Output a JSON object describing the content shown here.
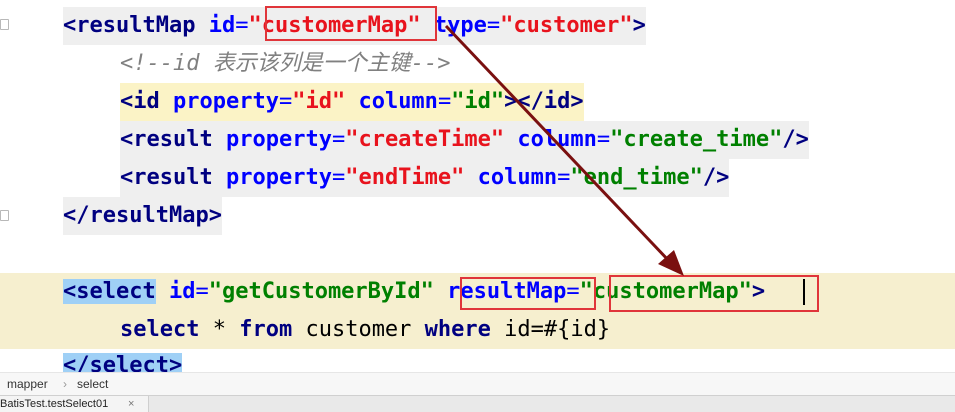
{
  "code": {
    "line1": {
      "open": "<",
      "tag": "resultMap",
      "sp1": " ",
      "attr1": "id",
      "eq1": "=",
      "val1": "\"customerMap\"",
      "sp2": " ",
      "attr2": "type",
      "eq2": "=",
      "val2": "\"customer\"",
      "close": ">"
    },
    "line2": {
      "comment": "<!--id 表示该列是一个主键-->"
    },
    "line3": {
      "open": "<",
      "tag": "id",
      "sp1": " ",
      "attr1": "property",
      "eq1": "=",
      "val1": "\"id\"",
      "sp2": " ",
      "attr2": "column",
      "eq2": "=",
      "val2": "\"id\"",
      "close": "></",
      "tag2": "id",
      "close2": ">"
    },
    "line4": {
      "open": "<",
      "tag": "result",
      "sp1": " ",
      "attr1": "property",
      "eq1": "=",
      "val1": "\"createTime\"",
      "sp2": " ",
      "attr2": "column",
      "eq2": "=",
      "val2": "\"create_time\"",
      "close": "/>"
    },
    "line5": {
      "open": "<",
      "tag": "result",
      "sp1": " ",
      "attr1": "property",
      "eq1": "=",
      "val1": "\"endTime\"",
      "sp2": " ",
      "attr2": "column",
      "eq2": "=",
      "val2": "\"end_time\"",
      "close": "/>"
    },
    "line6": {
      "open": "</",
      "tag": "resultMap",
      "close": ">"
    },
    "line8": {
      "open": "<",
      "tag": "select",
      "sp1": " ",
      "attr1": "id",
      "eq1": "=",
      "val1": "\"getCustomerById\"",
      "sp2": " ",
      "attr2": "resultMap",
      "eq2": "=",
      "val2": "\"customerMap\"",
      "close": ">"
    },
    "line9": {
      "kw1": "select",
      "t1": " * ",
      "kw2": "from",
      "t2": " customer ",
      "kw3": "where",
      "t3": " id=#{id}"
    },
    "line10": {
      "open": "</",
      "tag": "select",
      "close": ">"
    }
  },
  "breadcrumb": {
    "item1": "mapper",
    "sep": "›",
    "item2": "select"
  },
  "tab": {
    "label": "BatisTest.testSelect01",
    "close": "×"
  },
  "colors": {
    "annotation": "#e0353a",
    "arrow": "#7a1010",
    "highlight": "#f6efcf",
    "tag": "#000080",
    "attribute": "#0000ff",
    "value": "#008000"
  }
}
